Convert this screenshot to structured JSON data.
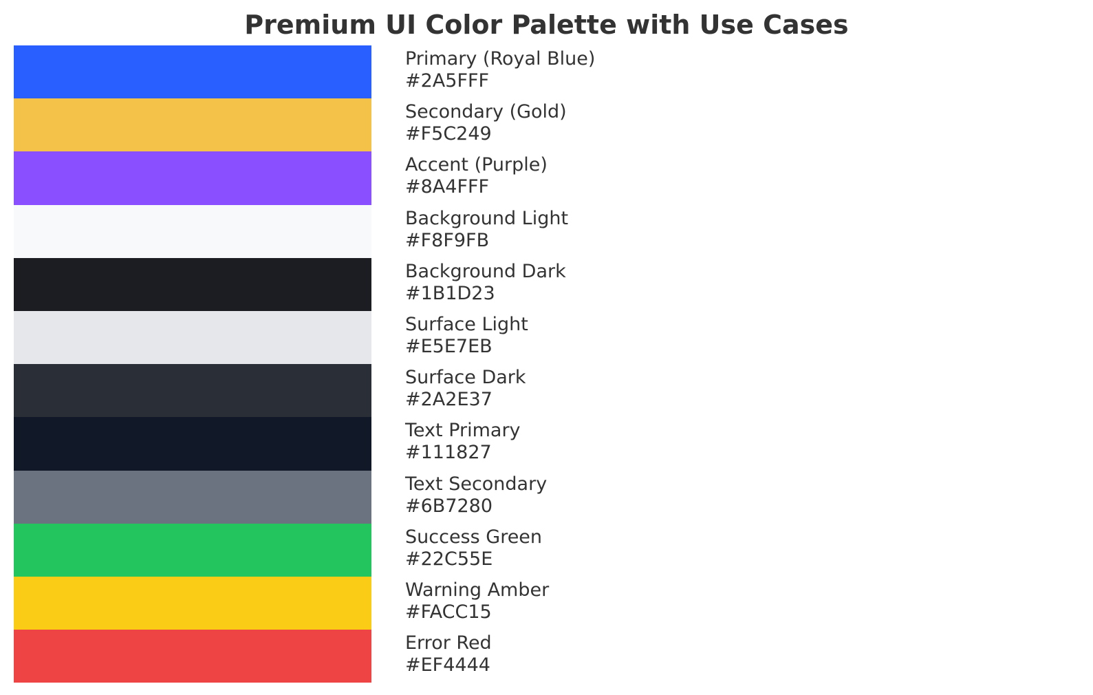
{
  "title": "Premium UI Color Palette with Use Cases",
  "colors": [
    {
      "name": "Primary (Royal Blue)",
      "hex": "#2A5FFF"
    },
    {
      "name": "Secondary (Gold)",
      "hex": "#F5C249"
    },
    {
      "name": "Accent (Purple)",
      "hex": "#8A4FFF"
    },
    {
      "name": "Background Light",
      "hex": "#F8F9FB"
    },
    {
      "name": "Background Dark",
      "hex": "#1B1D23"
    },
    {
      "name": "Surface Light",
      "hex": "#E5E7EB"
    },
    {
      "name": "Surface Dark",
      "hex": "#2A2E37"
    },
    {
      "name": "Text Primary",
      "hex": "#111827"
    },
    {
      "name": "Text Secondary",
      "hex": "#6B7280"
    },
    {
      "name": "Success Green",
      "hex": "#22C55E"
    },
    {
      "name": "Warning Amber",
      "hex": "#FACC15"
    },
    {
      "name": "Error Red",
      "hex": "#EF4444"
    }
  ]
}
